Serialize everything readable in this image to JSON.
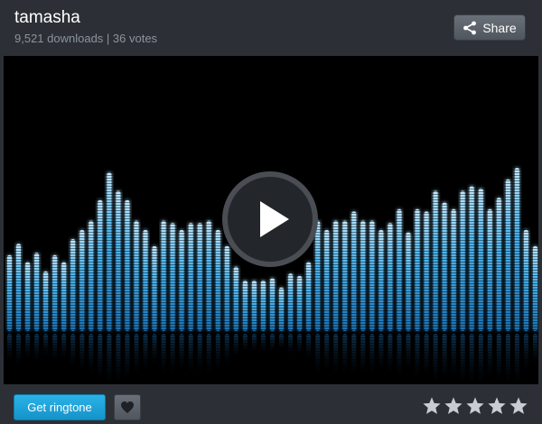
{
  "header": {
    "title": "tamasha",
    "downloads": "9,521 downloads | 36 votes",
    "share_label": "Share"
  },
  "player": {
    "play_icon": "play-icon",
    "visualizer_levels": [
      0.33,
      0.38,
      0.3,
      0.34,
      0.26,
      0.33,
      0.3,
      0.4,
      0.44,
      0.48,
      0.57,
      0.69,
      0.61,
      0.57,
      0.48,
      0.44,
      0.37,
      0.48,
      0.47,
      0.44,
      0.47,
      0.47,
      0.48,
      0.44,
      0.37,
      0.28,
      0.22,
      0.22,
      0.22,
      0.23,
      0.19,
      0.25,
      0.24,
      0.3,
      0.48,
      0.44,
      0.48,
      0.48,
      0.52,
      0.48,
      0.48,
      0.44,
      0.47,
      0.53,
      0.43,
      0.53,
      0.52,
      0.61,
      0.56,
      0.53,
      0.61,
      0.63,
      0.62,
      0.53,
      0.58,
      0.66,
      0.71,
      0.44,
      0.37
    ]
  },
  "footer": {
    "get_label": "Get ringtone",
    "fav_icon": "heart-icon",
    "rating_stars": 5,
    "rating_value": 0
  },
  "colors": {
    "accent": "#1da5dc",
    "background": "#2c3036",
    "muted_text": "#8c939b",
    "star": "#c9ccd0"
  }
}
